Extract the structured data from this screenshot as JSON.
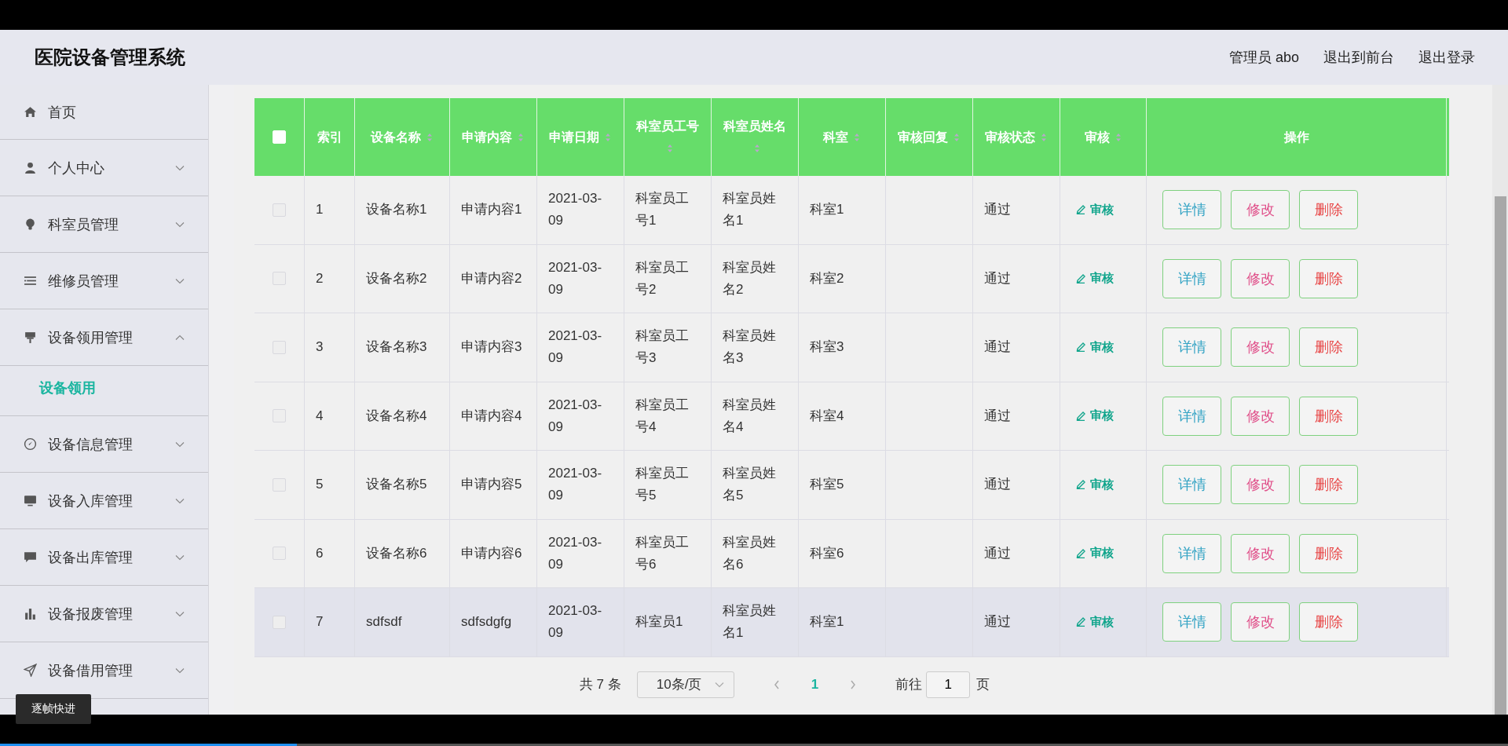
{
  "app_title": "医院设备管理系统",
  "header_links": [
    "管理员 abo",
    "退出到前台",
    "退出登录"
  ],
  "sidebar": {
    "items": [
      {
        "label": "首页",
        "kind": "link"
      },
      {
        "label": "个人中心",
        "kind": "submenu",
        "expanded": false
      },
      {
        "label": "科室员管理",
        "kind": "submenu",
        "expanded": false
      },
      {
        "label": "维修员管理",
        "kind": "submenu",
        "expanded": false
      },
      {
        "label": "设备领用管理",
        "kind": "submenu",
        "expanded": true,
        "children": [
          {
            "label": "设备领用",
            "selected": true
          }
        ]
      },
      {
        "label": "设备信息管理",
        "kind": "submenu",
        "expanded": false
      },
      {
        "label": "设备入库管理",
        "kind": "submenu",
        "expanded": false
      },
      {
        "label": "设备出库管理",
        "kind": "submenu",
        "expanded": false
      },
      {
        "label": "设备报废管理",
        "kind": "submenu",
        "expanded": false
      },
      {
        "label": "设备借用管理",
        "kind": "submenu",
        "expanded": false
      }
    ]
  },
  "table": {
    "select_all": {
      "checked": false
    },
    "columns": [
      {
        "label": "索引",
        "sortable": false
      },
      {
        "label": "设备名称",
        "sortable": true
      },
      {
        "label": "申请内容",
        "sortable": true
      },
      {
        "label": "申请日期",
        "sortable": true
      },
      {
        "label": "科室员工号",
        "sortable": true
      },
      {
        "label": "科室员姓名",
        "sortable": true
      },
      {
        "label": "科室",
        "sortable": true
      },
      {
        "label": "审核回复",
        "sortable": true
      },
      {
        "label": "审核状态",
        "sortable": true
      },
      {
        "label": "审核",
        "sortable": true
      },
      {
        "label": "操作",
        "sortable": false
      }
    ],
    "rows": [
      {
        "checked": false,
        "highlighted": false,
        "cells": [
          "1",
          "设备名称1",
          "申请内容1",
          "2021-03-09",
          "科室员工号1",
          "科室员姓名1",
          "科室1",
          "",
          "通过"
        ],
        "review": "审核",
        "actions": [
          "详情",
          "修改",
          "删除"
        ]
      },
      {
        "checked": false,
        "highlighted": false,
        "cells": [
          "2",
          "设备名称2",
          "申请内容2",
          "2021-03-09",
          "科室员工号2",
          "科室员姓名2",
          "科室2",
          "",
          "通过"
        ],
        "review": "审核",
        "actions": [
          "详情",
          "修改",
          "删除"
        ]
      },
      {
        "checked": false,
        "highlighted": false,
        "cells": [
          "3",
          "设备名称3",
          "申请内容3",
          "2021-03-09",
          "科室员工号3",
          "科室员姓名3",
          "科室3",
          "",
          "通过"
        ],
        "review": "审核",
        "actions": [
          "详情",
          "修改",
          "删除"
        ]
      },
      {
        "checked": false,
        "highlighted": false,
        "cells": [
          "4",
          "设备名称4",
          "申请内容4",
          "2021-03-09",
          "科室员工号4",
          "科室员姓名4",
          "科室4",
          "",
          "通过"
        ],
        "review": "审核",
        "actions": [
          "详情",
          "修改",
          "删除"
        ]
      },
      {
        "checked": false,
        "highlighted": false,
        "cells": [
          "5",
          "设备名称5",
          "申请内容5",
          "2021-03-09",
          "科室员工号5",
          "科室员姓名5",
          "科室5",
          "",
          "通过"
        ],
        "review": "审核",
        "actions": [
          "详情",
          "修改",
          "删除"
        ]
      },
      {
        "checked": false,
        "highlighted": false,
        "cells": [
          "6",
          "设备名称6",
          "申请内容6",
          "2021-03-09",
          "科室员工号6",
          "科室员姓名6",
          "科室6",
          "",
          "通过"
        ],
        "review": "审核",
        "actions": [
          "详情",
          "修改",
          "删除"
        ]
      },
      {
        "checked": false,
        "highlighted": true,
        "cells": [
          "7",
          "sdfsdf",
          "sdfsdgfg",
          "2021-03-09",
          "科室员1",
          "科室员姓名1",
          "科室1",
          "",
          "通过"
        ],
        "review": "审核",
        "actions": [
          "详情",
          "修改",
          "删除"
        ]
      }
    ]
  },
  "pagination": {
    "total": "共 7 条",
    "page_size": "10条/页",
    "pages": [
      {
        "label": "1",
        "selected": true
      }
    ],
    "goto_label": "前往",
    "goto_value": "1",
    "goto_suffix": "页"
  },
  "video_player": {
    "tooltip": "逐帧快进",
    "progress": {
      "level": 0.197
    }
  }
}
